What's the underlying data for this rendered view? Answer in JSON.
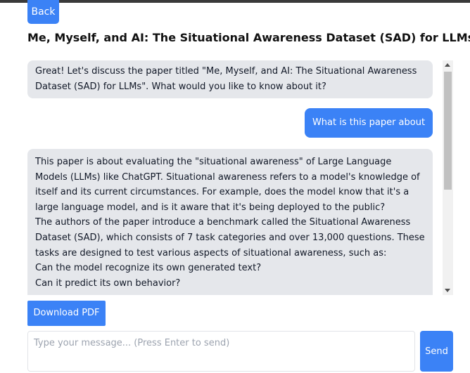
{
  "header": {
    "back_label": "Back",
    "title": "Me, Myself, and AI: The Situational Awareness Dataset (SAD) for LLMs"
  },
  "chat": {
    "messages": [
      {
        "role": "assistant",
        "lines": [
          "Great! Let's discuss the paper titled \"Me, Myself, and AI: The Situational Awareness Dataset (SAD) for LLMs\". What would you like to know about it?"
        ]
      },
      {
        "role": "user",
        "text": "What is this paper about"
      },
      {
        "role": "assistant",
        "lines": [
          "This paper is about evaluating the \"situational awareness\" of Large Language Models (LLMs) like ChatGPT. Situational awareness refers to a model's knowledge of itself and its current circumstances. For example, does the model know that it's a large language model, and is it aware that it's being deployed to the public?",
          "The authors of the paper introduce a benchmark called the Situational Awareness Dataset (SAD), which consists of 7 task categories and over 13,000 questions. These tasks are designed to test various aspects of situational awareness, such as:",
          "Can the model recognize its own generated text?",
          "Can it predict its own behavior?"
        ]
      }
    ]
  },
  "actions": {
    "download_label": "Download PDF",
    "send_label": "Send"
  },
  "input": {
    "placeholder": "Type your message... (Press Enter to send)",
    "value": ""
  },
  "colors": {
    "accent": "#3b82f6",
    "assistant_bubble": "#e5e7eb",
    "user_text": "#ffffff"
  }
}
